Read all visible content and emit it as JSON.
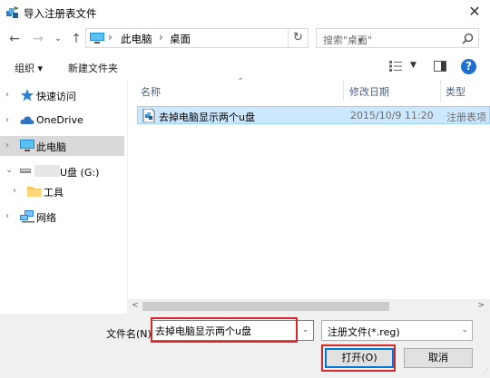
{
  "window": {
    "title": "导入注册表文件",
    "close_glyph": "✕"
  },
  "nav": {
    "back_glyph": "←",
    "forward_glyph": "→",
    "up_glyph": "↑",
    "recent_glyph": "⌄",
    "breadcrumb": [
      "此电脑",
      "桌面"
    ],
    "crumb_sep": "›",
    "refresh_glyph": "↻",
    "search_placeholder": "搜索\"桌面\""
  },
  "toolbar": {
    "organize_label": "组织 ▾",
    "new_folder_label": "新建文件夹",
    "help_label": "?"
  },
  "sidebar": {
    "items": [
      {
        "label": "快速访问",
        "icon": "star-icon",
        "expanded": false,
        "selected": false
      },
      {
        "label": "OneDrive",
        "icon": "cloud-icon",
        "expanded": false,
        "selected": false
      },
      {
        "label": "此电脑",
        "icon": "computer-icon",
        "expanded": false,
        "selected": true
      },
      {
        "label": "U盘 (G:)",
        "icon": "usb-drive-icon",
        "expanded": true,
        "selected": false
      },
      {
        "label": "工具",
        "icon": "folder-icon",
        "expanded": false,
        "selected": false
      },
      {
        "label": "网络",
        "icon": "network-icon",
        "expanded": false,
        "selected": false
      }
    ]
  },
  "columns": {
    "name": "名称",
    "modified": "修改日期",
    "type": "类型"
  },
  "files": [
    {
      "name": "去掉电脑显示两个u盘",
      "modified": "2015/10/9 11:20",
      "type": "注册表项",
      "icon": "registry-file-icon"
    }
  ],
  "footer": {
    "filename_label": "文件名(N):",
    "filename_value": "去掉电脑显示两个u盘",
    "filetype_value": "注册文件(*.reg)",
    "open_label": "打开(O)",
    "cancel_label": "取消"
  },
  "colors": {
    "selection": "#cce8ff",
    "selection_border": "#99d1ff",
    "highlight_annotation": "#d6282b",
    "accent": "#0078d7"
  }
}
